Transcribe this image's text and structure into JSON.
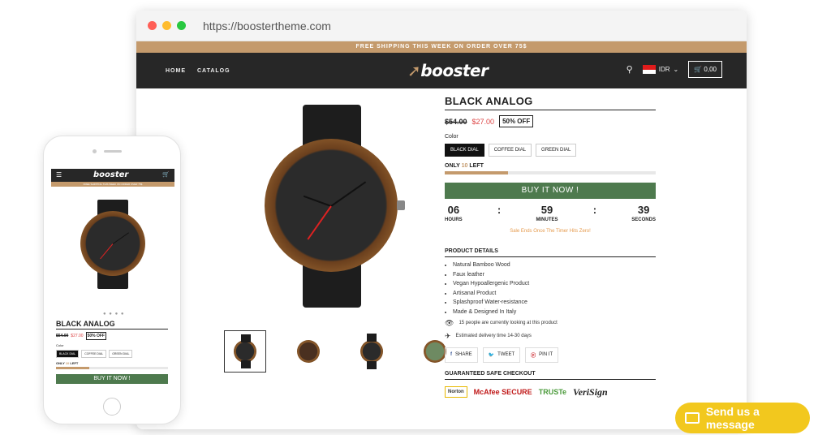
{
  "browser": {
    "url": "https://boostertheme.com",
    "dot_colors": [
      "#ff5f57",
      "#febc2e",
      "#28c840"
    ]
  },
  "store": {
    "promo_text": "FREE SHIPPING THIS WEEK ON ORDER OVER 75$",
    "nav_links": [
      "HOME",
      "CATALOG"
    ],
    "logo_text": "booster",
    "currency": "IDR",
    "cart_text": "0,00",
    "accent_color": "#c49a6c",
    "nav_bg": "#272727"
  },
  "product": {
    "title": "BLACK ANALOG",
    "old_price": "$54.00",
    "new_price": "$27.00",
    "discount": "50% OFF",
    "color_label": "Color",
    "options": [
      "BLACK DIAL",
      "COFFEE DIAL",
      "GREEN DIAL"
    ],
    "selected_option": "BLACK DIAL",
    "stock_prefix": "ONLY",
    "stock_count": "10",
    "stock_suffix": "LEFT",
    "stock_fraction": 0.3,
    "buy_label": "BUY IT NOW !",
    "buy_color": "#4e7a4e",
    "timer": {
      "hours": "06",
      "minutes": "59",
      "seconds": "39",
      "hours_label": "HOURS",
      "minutes_label": "MINUTES",
      "seconds_label": "SECONDS"
    },
    "sale_note": "Sale Ends Once The Timer Hits Zero!",
    "details_title": "PRODUCT DETAILS",
    "details": [
      "Natural Bamboo Wood",
      "Faux leather",
      "Vegan Hypoallergenic Product",
      "Artisanal Product",
      "Splashproof Water-resistance",
      "Made & Designed In Italy"
    ],
    "viewers_text": "15 people are currently looking at this product",
    "delivery_text": "Estimated delivery time 14-30 days",
    "share": {
      "facebook": "SHARE",
      "twitter": "TWEET",
      "pinterest": "PIN IT"
    },
    "checkout_title": "GUARANTEED SAFE CHECKOUT",
    "trust_badges": [
      "Norton",
      "McAfee SECURE",
      "TRUSTe",
      "VeriSign"
    ]
  },
  "mobile": {
    "logo_text": "booster",
    "promo_text": "FREE SHIPPING THIS WEEK ON ORDER OVER 75$",
    "title": "BLACK ANALOG",
    "old_price": "$54.00",
    "new_price": "$27.00",
    "discount": "50% OFF",
    "color_label": "Color",
    "options": [
      "BLACK DIAL",
      "COFFEE DIAL",
      "GREEN DIAL"
    ],
    "stock_prefix": "ONLY",
    "stock_count": "10",
    "stock_suffix": "LEFT",
    "buy_label": "BUY IT NOW !",
    "carousel_dots": "● ● ● ●"
  },
  "chat": {
    "label": "Send us a message",
    "color": "#f2c81e"
  }
}
